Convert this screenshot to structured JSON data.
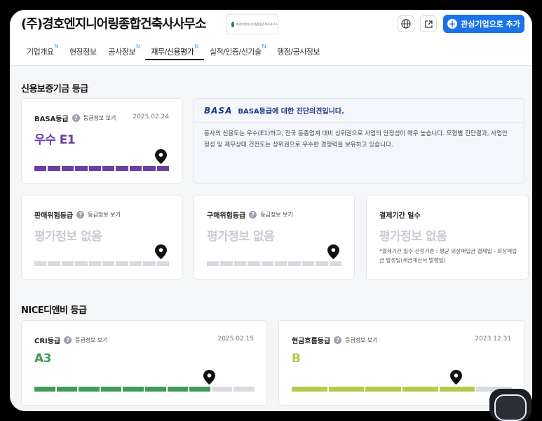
{
  "header": {
    "company_name": "(주)경호엔지니어링종합건축사사무소",
    "logo_text": "㈜경호엔지니어링종합건축사사무소",
    "add_button_label": "관심기업으로 추가",
    "icons": {
      "globe": "globe-icon",
      "share": "external-link-icon",
      "add": "plus-icon"
    }
  },
  "tabs": [
    {
      "label": "기업개요",
      "badge": "N"
    },
    {
      "label": "현장정보",
      "badge": ""
    },
    {
      "label": "공사정보",
      "badge": "N"
    },
    {
      "label": "재무/신용평가",
      "badge": "N",
      "active": true
    },
    {
      "label": "실적/인증/신기술",
      "badge": "N"
    },
    {
      "label": "행정/공시정보",
      "badge": ""
    }
  ],
  "section1": {
    "title": "신용보증기금 등급",
    "basa": {
      "label": "BASA등급",
      "info_link": "등급정보 보기",
      "date": "2025.02.24",
      "grade": "우수 E1",
      "color": "#6b3fa0",
      "segments": 10,
      "filled": 10,
      "marker_index": 9
    },
    "opinion": {
      "logo": "BASA",
      "title": "BASA등급에 대한 진단의견입니다.",
      "body": "동사의 신용도는 우수(E1)하고, 전국 동종업계 대비 상위권으로 사업의 안정성이 매우 높습니다. 모형별 진단결과, 사업안정성 및 재무상태 건전도는 상위권으로 우수한 경쟁력을 보유하고 있습니다."
    },
    "sales_risk": {
      "label": "판매위험등급",
      "info_link": "등급정보 보기",
      "grade": "평가정보 없음",
      "segments": 10,
      "marker_index": 9
    },
    "purchase_risk": {
      "label": "구매위험등급",
      "info_link": "등급정보 보기",
      "grade": "평가정보 없음",
      "segments": 10,
      "marker_index": 9
    },
    "settlement": {
      "label": "결제기간 일수",
      "grade": "평가정보 없음",
      "note": "*결제기간 일수 산정기준 : 평균 외상매입금 결제일 - 외상매입금 발생일(세금계산서 발행일)"
    }
  },
  "section2": {
    "title": "NICE디앤비 등급",
    "cri": {
      "label": "CRI등급",
      "info_link": "등급정보 보기",
      "date": "2025.02.15",
      "grade": "A3",
      "color": "#3f9c5a",
      "segments": 10,
      "filled": 8,
      "marker_index": 7
    },
    "cashflow": {
      "label": "현금흐름등급",
      "info_link": "등급정보 보기",
      "date": "2023.12.31",
      "grade": "B",
      "color": "#b8c94a",
      "segments": 6,
      "filled": 5,
      "marker_index": 4
    }
  }
}
